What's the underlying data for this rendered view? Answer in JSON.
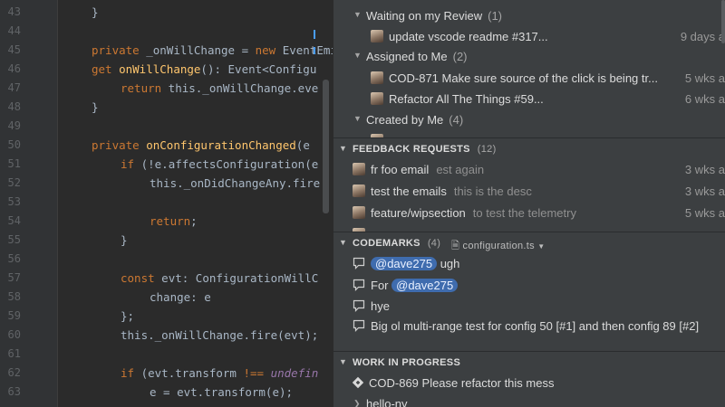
{
  "editor": {
    "line_numbers": [
      "43",
      "44",
      "45",
      "46",
      "47",
      "48",
      "49",
      "50",
      "51",
      "52",
      "53",
      "54",
      "55",
      "56",
      "57",
      "58",
      "59",
      "60",
      "61",
      "62",
      "63"
    ]
  },
  "review": {
    "waiting": {
      "label": "Waiting on my Review",
      "count": "(1)",
      "items": [
        {
          "title": "update vscode readme #317...",
          "age": "9 days a"
        }
      ]
    },
    "assigned": {
      "label": "Assigned to Me",
      "count": "(2)",
      "items": [
        {
          "title": "COD-871 Make sure source of the click is being tr...",
          "age": "5 wks a"
        },
        {
          "title": "Refactor All The Things #59...",
          "age": "6 wks a"
        }
      ]
    },
    "created": {
      "label": "Created by Me",
      "count": "(4)"
    }
  },
  "feedback": {
    "title": "FEEDBACK REQUESTS",
    "count": "(12)",
    "items": [
      {
        "title": "fr foo email",
        "desc": "est again",
        "age": "3 wks a"
      },
      {
        "title": "test the emails",
        "desc": "this is the desc",
        "age": "3 wks a"
      },
      {
        "title": "feature/wipsection",
        "desc": "to test the telemetry",
        "age": "5 wks a"
      }
    ]
  },
  "codemarks": {
    "title": "CODEMARKS",
    "count": "(4)",
    "file": "configuration.ts",
    "items": [
      {
        "mention": "@dave275",
        "text": " ugh"
      },
      {
        "prefix": "For ",
        "mention": "@dave275"
      },
      {
        "text": "hye"
      },
      {
        "text": "Big ol multi-range test for config 50 [#1] and then config 89 [#2]"
      }
    ]
  },
  "wip": {
    "title": "WORK IN PROGRESS",
    "items": [
      {
        "title": "COD-869 Please refactor this mess"
      },
      {
        "title": "hello-ny"
      }
    ]
  },
  "colors": {
    "accent": "#3f6cae",
    "panel_bg": "#3c3f41",
    "editor_bg": "#2b2b2b"
  }
}
